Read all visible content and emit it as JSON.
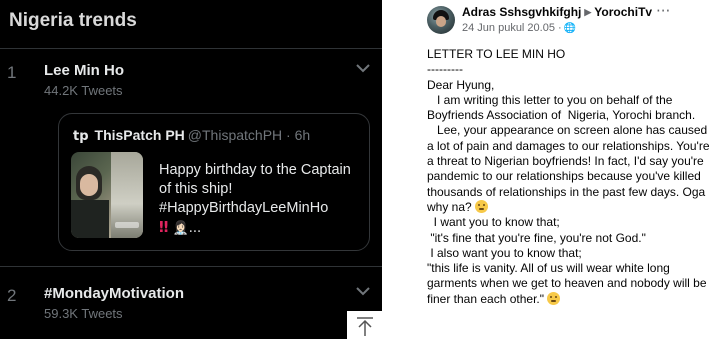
{
  "twitter": {
    "section_title": "Nigeria trends",
    "trends": [
      {
        "rank": "1",
        "name": "Lee Min Ho",
        "count": "44.2K Tweets"
      },
      {
        "rank": "2",
        "name": "#MondayMotivation",
        "count": "59.3K Tweets"
      }
    ],
    "tweet": {
      "logo": "tp",
      "author": "ThisPatch PH",
      "handle": "@ThispatchPH · 6h",
      "text": "Happy birthday to the Captain of this ship! #HappyBirthdayLeeMinHo",
      "emoji_exclamation": "‼",
      "emoji_person": "👩🏻‍⚕️",
      "ellipsis": "..."
    },
    "icons": {
      "chevron": "chevron-down-icon",
      "scroll_top": "arrow-up-icon"
    }
  },
  "facebook": {
    "poster_name": "Adras Sshsgvhkifghj",
    "group_name": "YorochiTv",
    "arrow": "▶",
    "date": "24 Jun pukul 20.05 ·",
    "globe": "🌐",
    "more": "···",
    "body": {
      "title": "LETTER TO LEE MIN HO",
      "rule": "---------",
      "greeting": "Dear Hyung,",
      "p1": "   I am writing this letter to you on behalf of the Boyfriends Association of  Nigeria, Yorochi branch.",
      "p2": "   Lee, your appearance on screen alone has caused a lot of pain and damages to our relationships. You're a threat to Nigerian boyfriends! In fact, I'd say you're pandemic to our relationships because you've killed thousands of relationships in the past few days. Oga why na?",
      "p3": "  I want you to know that;",
      "p4": " \"it's fine that you're fine, you're not God.\"",
      "p5": " I also want you to know that;",
      "p6": "\"this life is vanity. All of us will wear white long garments when we get to heaven and nobody will be finer than each other.\""
    }
  }
}
